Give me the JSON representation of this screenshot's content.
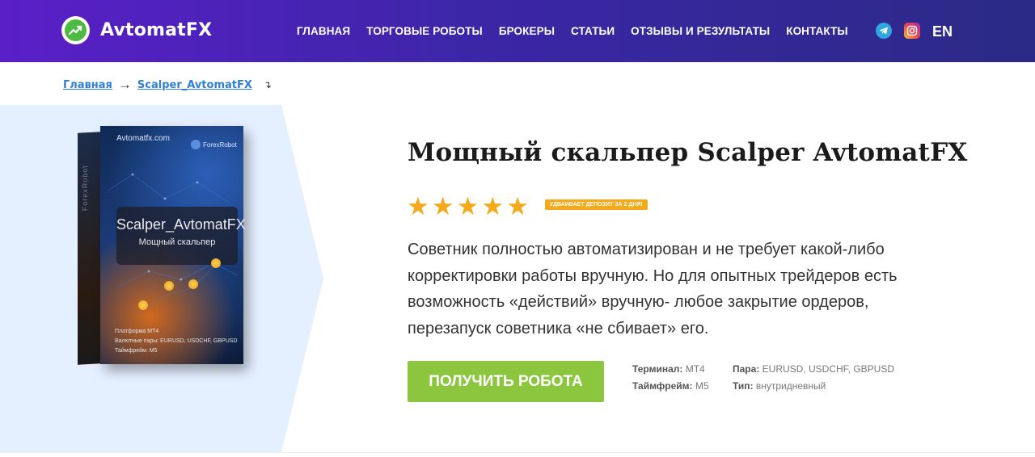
{
  "header": {
    "logo_text": "AvtomatFX",
    "nav": [
      {
        "label": "ГЛАВНАЯ"
      },
      {
        "label": "ТОРГОВЫЕ РОБОТЫ"
      },
      {
        "label": "БРОКЕРЫ"
      },
      {
        "label": "СТАТЬИ"
      },
      {
        "label": "ОТЗЫВЫ И РЕЗУЛЬТАТЫ"
      },
      {
        "label": "КОНТАКТЫ"
      }
    ],
    "social": {
      "telegram_icon": "telegram-icon",
      "instagram_icon": "instagram-icon"
    },
    "lang": "EN",
    "colors": {
      "gradient_start": "#5a1fc8",
      "gradient_end": "#2b2a86"
    }
  },
  "breadcrumb": {
    "home": "Главная",
    "separator": "→",
    "current": "Scalper_AvtomatFX",
    "mark": "↴"
  },
  "product_image": {
    "site": "Avtomatfx.com",
    "brand": "ForexRobot",
    "side_text": "ForexRobot",
    "title": "Scalper_AvtomatFX",
    "subtitle": "Мощный скальпер",
    "info_platform": "Платформа МТ4",
    "info_pairs": "Валютные пары: EURUSD, USDCHF, GBPUSD",
    "info_timeframe": "Таймфрейм: М5"
  },
  "product": {
    "title": "Мощный скальпер Scalper AvtomatFX",
    "rating": 5,
    "stars": [
      "★",
      "★",
      "★",
      "★",
      "★"
    ],
    "badge": "УДВАИВАЕТ ДЕПОЗИТ ЗА 2 ДНЯ!",
    "description": "Советник полностью автоматизирован и не требует какой-либо корректировки работы вручную. Но для опытных трейдеров есть возможность «действий» вручную- любое закрытие ордеров, перезапуск советника «не сбивает» его.",
    "cta": "ПОЛУЧИТЬ РОБОТА",
    "specs": {
      "terminal_label": "Терминал:",
      "terminal_value": "MT4",
      "timeframe_label": "Таймфрейм:",
      "timeframe_value": "M5",
      "pair_label": "Пара:",
      "pair_value": "EURUSD, USDCHF, GBPUSD",
      "type_label": "Тип:",
      "type_value": "внутридневный"
    },
    "colors": {
      "star": "#f4a91a",
      "cta": "#8cc63f",
      "panel": "#e4efff"
    }
  }
}
